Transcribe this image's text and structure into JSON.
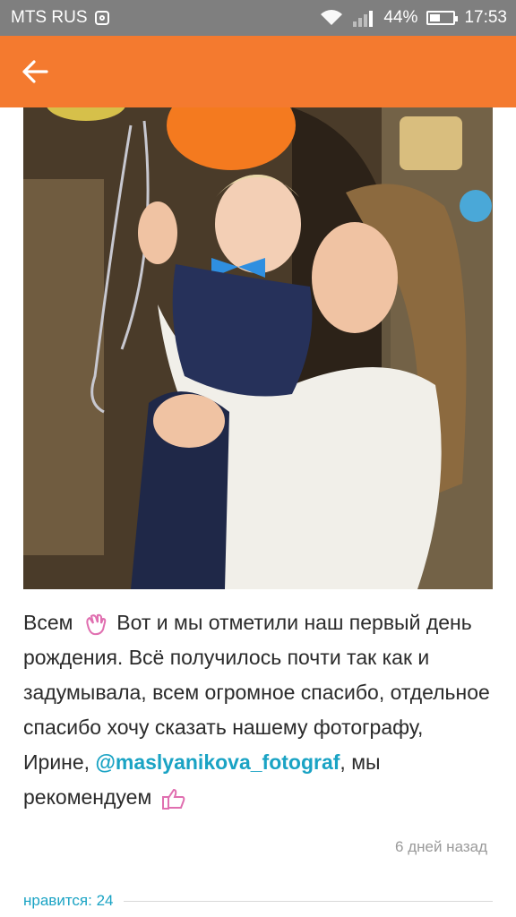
{
  "status_bar": {
    "carrier": "MTS RUS",
    "battery_percent": "44%",
    "battery_level": 0.44,
    "time": "17:53"
  },
  "app_bar": {
    "back_icon": "arrow-left-icon",
    "color": "#f47a2f"
  },
  "post": {
    "text_part1": "Всем",
    "text_part2": "Вот и мы отметили наш первый день рождения. Всё получилось почти так как и задумывала, всем огромное спасибо, отдельное спасибо хочу сказать нашему фотографу, Ирине,",
    "mention": "@maslyanikova_fotograf",
    "text_part3": ", мы рекомендуем",
    "emoji_1": "waving-hand-icon",
    "emoji_2": "thumbs-up-icon",
    "timestamp": "6 дней назад",
    "likes_label": "нравится: 24"
  },
  "colors": {
    "accent": "#f47a2f",
    "link": "#1aa3c4",
    "emoji": "#e06fb0"
  }
}
